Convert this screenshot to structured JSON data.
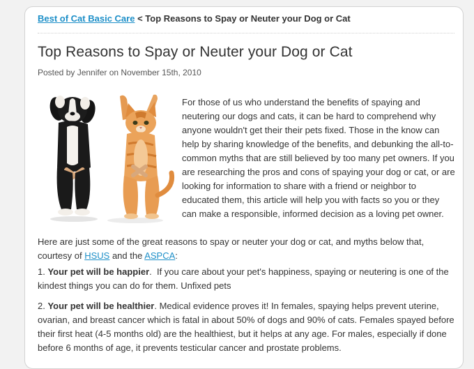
{
  "breadcrumb": {
    "parent_link": "Best of Cat Basic Care",
    "separator": " < ",
    "current": "Top Reasons to Spay or Neuter your Dog or Cat"
  },
  "post": {
    "title": "Top Reasons to Spay or Neuter your Dog or Cat",
    "meta": "Posted by Jennifer on November 15th, 2010",
    "intro": "For those of us who understand the benefits of spaying and neutering our dogs and cats, it can be hard to comprehend why anyone wouldn't get their their pets fixed. Those in the know can help by sharing knowledge of the benefits, and debunking the all-to-common myths that are still believed by too many pet owners. If you are researching the pros and cons of spaying your dog or cat, or are looking for information to share with a friend or neighbor to educated them, this article will help you with facts so you or they can make a responsible, informed decision as a loving pet owner.",
    "reasons_intro_before": "Here are just some of the great reasons to spay or neuter your dog or cat, and myths below that, courtesy of ",
    "link_hsus": "HSUS",
    "reasons_intro_and": " and the ",
    "link_aspca": "ASPCA",
    "reasons_intro_end": ":",
    "reason1_num": "1. ",
    "reason1_bold": "Your pet will be happier",
    "reason1_text": ".  If you care about your pet's happiness, spaying or neutering is one of the kindest things you can do for them. Unfixed pets",
    "reason2_num": "2. ",
    "reason2_bold": "Your pet will be healthier",
    "reason2_text": ". Medical evidence proves it! In females, spaying helps prevent uterine, ovarian, and breast cancer which is fatal in about 50% of dogs and 90% of cats. Females spayed before their first heat (4-5 months old) are the healthiest, but it helps at any age. For males, especially if done before 6 months of age, it prevents testicular cancer and prostate problems."
  },
  "colors": {
    "link": "#1d8fc8",
    "text": "#333333",
    "card_border": "#d2d2d2"
  }
}
